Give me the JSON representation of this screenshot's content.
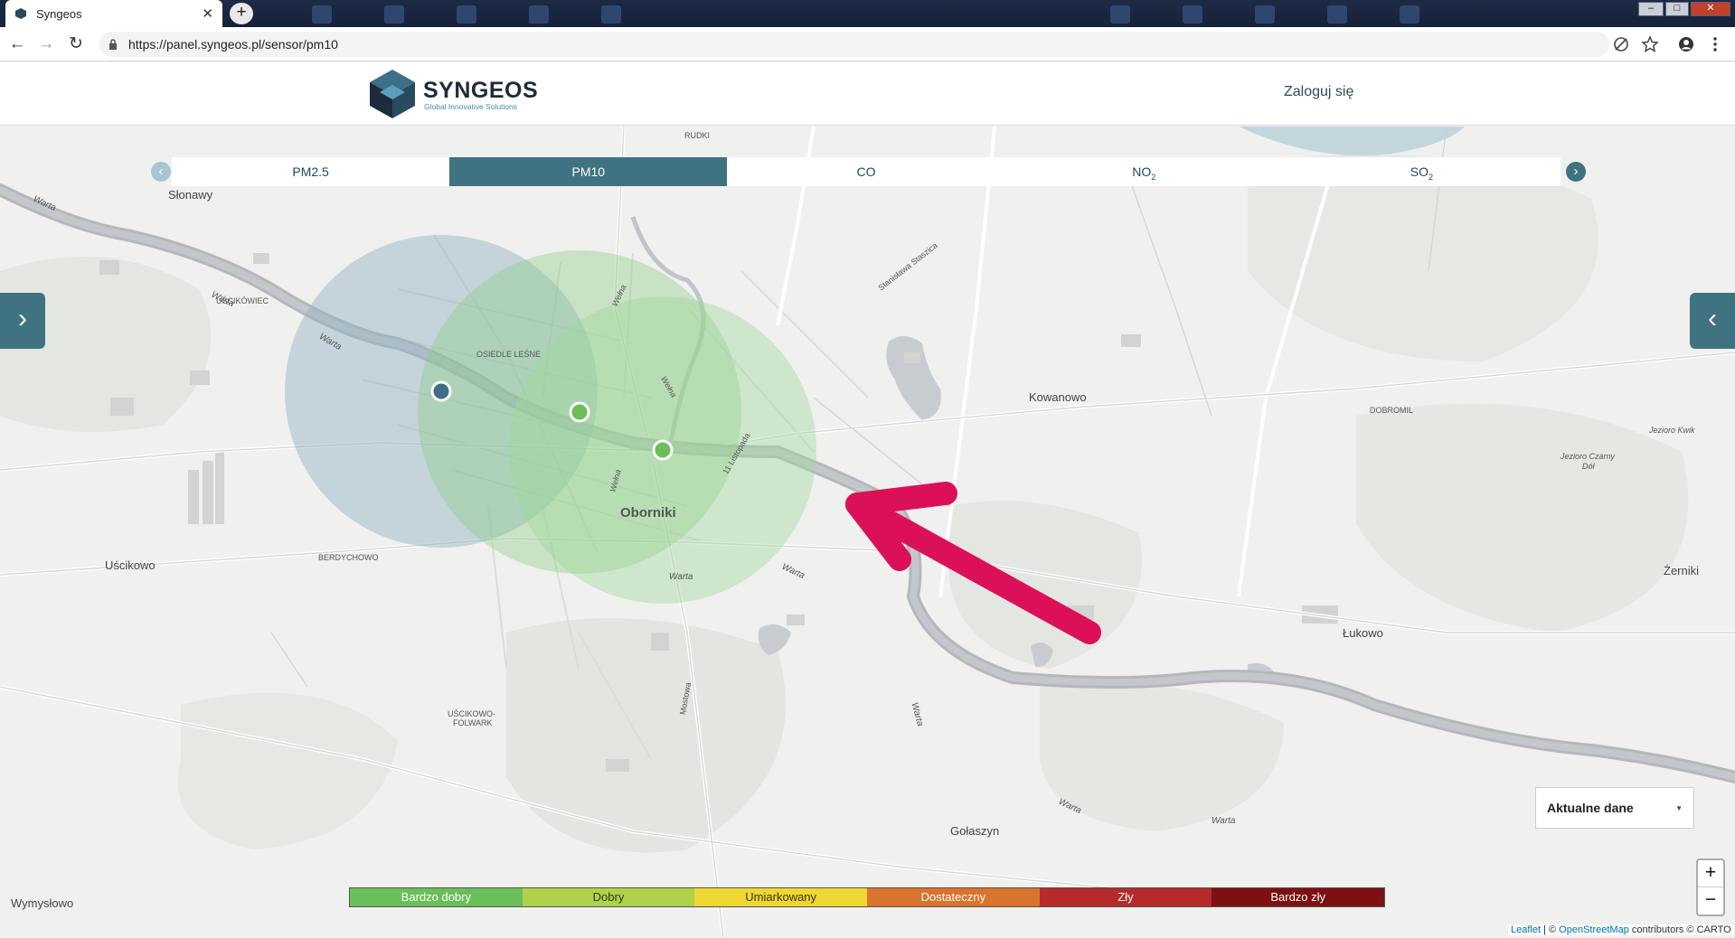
{
  "browser": {
    "tab_title": "Syngeos",
    "tab_close": "✕",
    "new_tab": "+",
    "url": "https://panel.syngeos.pl/sensor/pm10",
    "window_buttons": [
      "–",
      "□",
      "✕"
    ]
  },
  "header": {
    "brand": "SYNGEOS",
    "tagline": "Global Innovative Solutions",
    "login": "Zaloguj się"
  },
  "pollutant_tabs": {
    "items": [
      {
        "label": "PM2.5",
        "sub": ""
      },
      {
        "label": "PM10",
        "sub": ""
      },
      {
        "label": "CO",
        "sub": ""
      },
      {
        "label": "NO",
        "sub": "2"
      },
      {
        "label": "SO",
        "sub": "2"
      }
    ],
    "active_index": 1,
    "prev_arrow": "‹",
    "next_arrow": "›"
  },
  "side_tabs": {
    "left": "›",
    "right": "‹"
  },
  "map_labels": {
    "slonawy": "Słonawy",
    "uscikowiec": "UŚCIKÓWIEC",
    "osiedle": "OSIEDLE LEŚNE",
    "oborniki": "Oborniki",
    "berdychowo": "BERDYCHOWO",
    "uscikowo": "Uścikowo",
    "kowanowo": "Kowanowo",
    "dobromil": "DOBROMIL",
    "jeziorokwik": "Jezioro Kwik",
    "jeziorodol": "Jezioro Czarny",
    "jeziorodol2": "Dół",
    "zerniki": "Żerniki",
    "lukowo": "Łukowo",
    "uscikowofolwark": "UŚCIKOWO-",
    "uscikowofolwark2": "FOLWARK",
    "golaszyn": "Gołaszyn",
    "wymyslowo": "Wymysłowo",
    "rudki": "RUDKI",
    "warta1": "Warta",
    "warta2": "Warta",
    "warta3": "Warta",
    "warta4": "Warta",
    "warta5": "Warta",
    "warta6": "Warta",
    "warta7": "Warta",
    "warta8": "Warta",
    "welna1": "Wełna",
    "welna2": "Wełna",
    "welna3": "Wełna",
    "listopada": "11 Listopada",
    "staszica": "Stanisława Staszica",
    "mostowa": "Mostowa"
  },
  "legend": [
    {
      "label": "Bardzo dobry",
      "color": "#6abf5a"
    },
    {
      "label": "Dobry",
      "color": "#b0d14b"
    },
    {
      "label": "Umiarkowany",
      "color": "#f0d633"
    },
    {
      "label": "Dostateczny",
      "color": "#d9742e"
    },
    {
      "label": "Zły",
      "color": "#b52a2a"
    },
    {
      "label": "Bardzo zły",
      "color": "#7d1010"
    }
  ],
  "data_select": {
    "value": "Aktualne dane"
  },
  "zoom": {
    "in": "+",
    "out": "−"
  },
  "attribution": {
    "leaflet": "Leaflet",
    "sep1": " | © ",
    "osm": "OpenStreetMap",
    "contrib": " contributors © ",
    "carto": "CARTO"
  },
  "sensors": [
    {
      "name": "sensor-1",
      "status_color": "#3e6f82"
    },
    {
      "name": "sensor-2",
      "status_color": "#6abf5a"
    },
    {
      "name": "sensor-3",
      "status_color": "#6abf5a"
    }
  ]
}
